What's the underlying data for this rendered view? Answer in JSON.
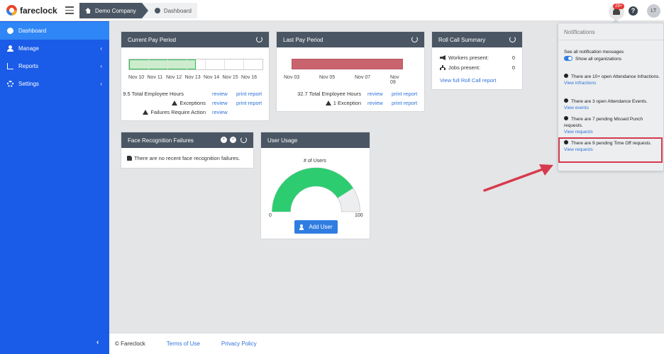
{
  "topbar": {
    "brand": "fareclock",
    "breadcrumb": [
      "Demo Company",
      "Dashboard"
    ],
    "notification_count": "29+",
    "help": "?",
    "avatar_initials": "LT"
  },
  "sidebar": {
    "items": [
      {
        "label": "Dashboard",
        "icon": "dashboard-icon",
        "active": true
      },
      {
        "label": "Manage",
        "icon": "user-icon",
        "chevron": "‹"
      },
      {
        "label": "Reports",
        "icon": "chart-icon",
        "chevron": "‹"
      },
      {
        "label": "Settings",
        "icon": "gear-icon",
        "chevron": "‹"
      }
    ],
    "collapse": "‹"
  },
  "current_pay": {
    "title": "Current Pay Period",
    "ticks": [
      "Nov 10",
      "Nov 11",
      "Nov 12",
      "Nov 13",
      "Nov 14",
      "Nov 15",
      "Nov 16"
    ],
    "progress": 0.5,
    "rows": [
      {
        "text": "9.5 Total Employee Hours",
        "review": "review",
        "print": "print report"
      },
      {
        "text": "Exceptions",
        "review": "review",
        "print": "print report"
      },
      {
        "text": "Failures Require Action",
        "review": "review"
      }
    ],
    "bar_color": "#2fbf5a"
  },
  "last_pay": {
    "title": "Last Pay Period",
    "ticks": [
      "Nov 03",
      "Nov 05",
      "Nov 07",
      "Nov 09"
    ],
    "rows": [
      {
        "text": "32.7 Total Employee Hours",
        "review": "review",
        "print": "print report"
      },
      {
        "text": "1 Exception",
        "review": "review",
        "print": "print report"
      }
    ],
    "bar_color": "#c9646e"
  },
  "roll_call": {
    "title": "Roll Call Summary",
    "workers_label": "Workers present:",
    "workers_value": "0",
    "jobs_label": "Jobs present:",
    "jobs_value": "0",
    "link": "View full Roll Call report"
  },
  "face": {
    "title": "Face Recognition Failures",
    "message": "There are no recent face recognition failures."
  },
  "usage": {
    "title": "User Usage",
    "chart_label": "# of Users",
    "min": "0",
    "max": "100",
    "fill": 0.82,
    "button": "Add User",
    "gauge_color": "#2ecc71"
  },
  "notifications": {
    "title": "Notifications",
    "see_all": "See all notification messages",
    "show_all": "Show all organizations",
    "items": [
      {
        "text": "There are 10+ open Attendance Infractions.",
        "link": "View infractions"
      },
      {
        "text": "There are 3 open Attendance Events.",
        "link": "View events"
      },
      {
        "text": "There are 7 pending Missed Punch requests.",
        "link": "View requests"
      },
      {
        "text": "There are 9 pending Time Off requests.",
        "link": "View requests"
      }
    ]
  },
  "footer": {
    "copyright": "© Fareclock",
    "terms": "Terms of Use",
    "privacy": "Privacy Policy"
  }
}
